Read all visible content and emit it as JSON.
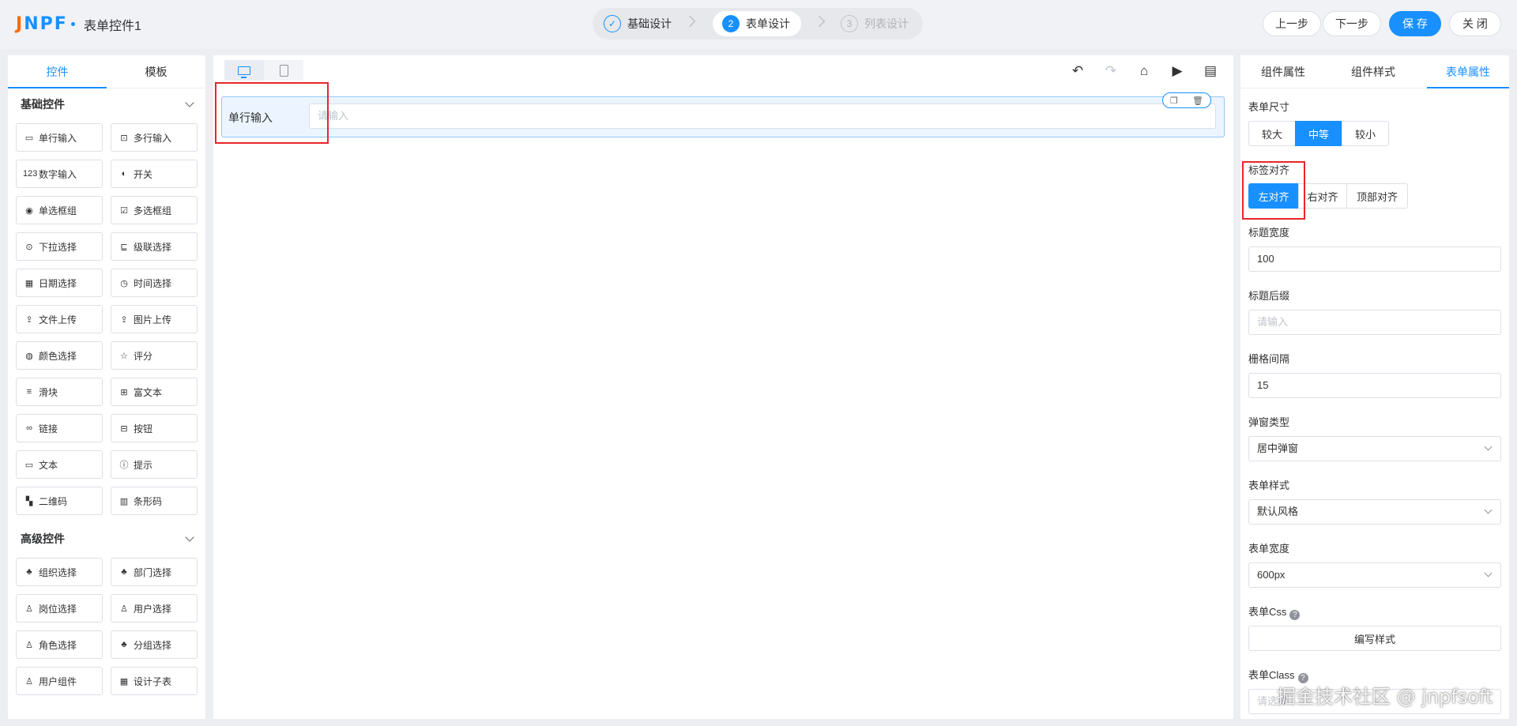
{
  "header": {
    "logo_text": "JNPF",
    "form_title": "表单控件1",
    "steps": [
      {
        "num": "✓",
        "label": "基础设计",
        "state": "done"
      },
      {
        "num": "2",
        "label": "表单设计",
        "state": "active"
      },
      {
        "num": "3",
        "label": "列表设计",
        "state": "pending"
      }
    ],
    "buttons": {
      "prev": "上一步",
      "next": "下一步",
      "save": "保 存",
      "close": "关 闭"
    }
  },
  "left_panel": {
    "tabs": [
      "控件",
      "模板"
    ],
    "active_tab": "控件",
    "sections": [
      {
        "title": "基础控件",
        "items": [
          {
            "label": "单行输入",
            "icon": "▭"
          },
          {
            "label": "多行输入",
            "icon": "⊡"
          },
          {
            "label": "数字输入",
            "icon": "123"
          },
          {
            "label": "开关",
            "icon": "◐"
          },
          {
            "label": "单选框组",
            "icon": "◉"
          },
          {
            "label": "多选框组",
            "icon": "☑"
          },
          {
            "label": "下拉选择",
            "icon": "⊙"
          },
          {
            "label": "级联选择",
            "icon": "⊑"
          },
          {
            "label": "日期选择",
            "icon": "▦"
          },
          {
            "label": "时间选择",
            "icon": "◷"
          },
          {
            "label": "文件上传",
            "icon": "⇪"
          },
          {
            "label": "图片上传",
            "icon": "⇪"
          },
          {
            "label": "颜色选择",
            "icon": "◍"
          },
          {
            "label": "评分",
            "icon": "☆"
          },
          {
            "label": "滑块",
            "icon": "≡"
          },
          {
            "label": "富文本",
            "icon": "⊞"
          },
          {
            "label": "链接",
            "icon": "∞"
          },
          {
            "label": "按钮",
            "icon": "⊟"
          },
          {
            "label": "文本",
            "icon": "▭"
          },
          {
            "label": "提示",
            "icon": "ⓘ"
          },
          {
            "label": "二维码",
            "icon": "▚"
          },
          {
            "label": "条形码",
            "icon": "▥"
          }
        ]
      },
      {
        "title": "高级控件",
        "items": [
          {
            "label": "组织选择",
            "icon": "♣"
          },
          {
            "label": "部门选择",
            "icon": "♣"
          },
          {
            "label": "岗位选择",
            "icon": "♙"
          },
          {
            "label": "用户选择",
            "icon": "♙"
          },
          {
            "label": "角色选择",
            "icon": "♙"
          },
          {
            "label": "分组选择",
            "icon": "♣"
          },
          {
            "label": "用户组件",
            "icon": "♙"
          },
          {
            "label": "设计子表",
            "icon": "▦"
          }
        ]
      }
    ]
  },
  "canvas": {
    "field": {
      "label": "单行输入",
      "placeholder": "请输入"
    },
    "toolbar": [
      "↶",
      "↷",
      "⌂",
      "▶",
      "▤"
    ]
  },
  "right_panel": {
    "tabs": [
      "组件属性",
      "组件样式",
      "表单属性"
    ],
    "active_tab": "表单属性",
    "size": {
      "label": "表单尺寸",
      "options": [
        "较大",
        "中等",
        "较小"
      ],
      "selected": "中等"
    },
    "align": {
      "label": "标签对齐",
      "options": [
        "左对齐",
        "右对齐",
        "顶部对齐"
      ],
      "selected": "左对齐"
    },
    "label_width": {
      "label": "标题宽度",
      "value": "100"
    },
    "label_suffix": {
      "label": "标题后缀",
      "placeholder": "请输入"
    },
    "gutter": {
      "label": "栅格间隔",
      "value": "15"
    },
    "popup_type": {
      "label": "弹窗类型",
      "value": "居中弹窗"
    },
    "form_style": {
      "label": "表单样式",
      "value": "默认风格"
    },
    "form_width": {
      "label": "表单宽度",
      "value": "600px"
    },
    "form_css": {
      "label": "表单Css",
      "button": "编写样式"
    },
    "form_class": {
      "label": "表单Class",
      "placeholder": "请选择"
    }
  },
  "watermark": "掘金技术社区 @ jnpfsoft",
  "colors": {
    "primary": "#1890ff",
    "highlight": "#e8262a",
    "logo_j": "#ff6a00"
  }
}
